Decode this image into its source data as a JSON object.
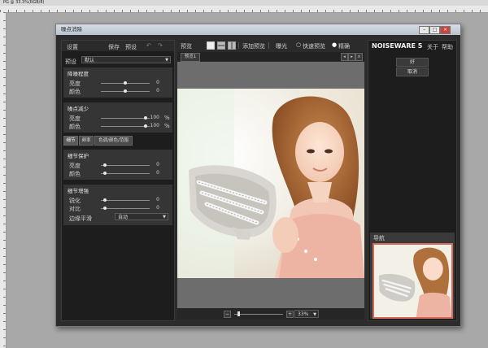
{
  "host": {
    "tab_title": "PG @ 33.3%(RGB/8)"
  },
  "window": {
    "title": "噪点消除",
    "minimize": "–",
    "maximize": "□",
    "close": "×"
  },
  "left_panel": {
    "settings_label": "设置",
    "save_button": "保存",
    "preset_button": "预设",
    "preset_label": "预设",
    "preset_value": "默认",
    "sections": [
      {
        "title": "降噪程度",
        "rows": [
          {
            "label": "亮度",
            "value": "0"
          },
          {
            "label": "颜色",
            "value": "0"
          }
        ]
      },
      {
        "title": "噪点减少",
        "rows": [
          {
            "label": "亮度",
            "value": "100",
            "unit": "%"
          },
          {
            "label": "颜色",
            "value": "100",
            "unit": "%"
          }
        ]
      },
      {
        "title": "细节保护",
        "rows": [
          {
            "label": "亮度",
            "value": "0"
          },
          {
            "label": "颜色",
            "value": "0"
          }
        ]
      },
      {
        "title": "细节增强",
        "rows": [
          {
            "label": "锐化",
            "value": "0"
          },
          {
            "label": "对比",
            "value": "0"
          }
        ]
      }
    ],
    "tabs": [
      "细节",
      "频率",
      "色调/颜色/范围"
    ],
    "sharpen_mode": {
      "label": "边缘平滑",
      "value": "自动"
    },
    "sliders": {
      "s1": 0.5,
      "s2": 0.5,
      "s3": 0.95,
      "s4": 0.95,
      "s5": 0.05,
      "s6": 0.05,
      "s7": 0.05,
      "s8": 0.05
    }
  },
  "toolbar": {
    "compare_label": "预览",
    "add_preview": "添加预览",
    "exposure": "曝光",
    "quick_preview": "快速预览",
    "accurate": "精确"
  },
  "center": {
    "tab_label": "预览1",
    "zoom_value": "33%"
  },
  "right_panel": {
    "brand": "NOISEWARE 5",
    "about": "关于",
    "help": "帮助",
    "ok": "好",
    "cancel": "取消",
    "navigator": "导航"
  }
}
